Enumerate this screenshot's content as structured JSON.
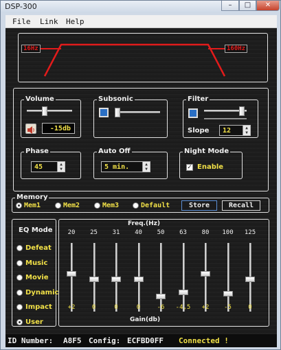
{
  "window": {
    "title": "DSP-300",
    "minimize": "–",
    "maximize": "□",
    "close": "✕"
  },
  "menu": {
    "file": "File",
    "link": "Link",
    "help": "Help"
  },
  "crossover": {
    "low_label": "16Hz",
    "high_label": "160Hz",
    "line_color": "#e21b1b"
  },
  "volume": {
    "title": "Volume",
    "value": "-15db",
    "level": 0.38,
    "icon": "speaker-icon"
  },
  "subsonic": {
    "title": "Subsonic",
    "level": 0.0
  },
  "filter": {
    "title": "Filter",
    "slope_label": "Slope",
    "slope_value": "12",
    "level": 0.95
  },
  "phase": {
    "title": "Phase",
    "value": "45"
  },
  "auto_off": {
    "title": "Auto Off",
    "value": "5 min."
  },
  "night_mode": {
    "title": "Night Mode",
    "enable_label": "Enable",
    "checked": true
  },
  "memory": {
    "title": "Memory",
    "options": [
      "Mem1",
      "Mem2",
      "Mem3",
      "Default"
    ],
    "selected": 0,
    "store": "Store",
    "recall": "Recall"
  },
  "eq_mode": {
    "title": "EQ Mode",
    "options": [
      "Defeat",
      "Music",
      "Movie",
      "Dynamic",
      "Impact",
      "User"
    ],
    "selected": 5
  },
  "eq": {
    "freq_title": "Freq.(Hz)",
    "gain_title": "Gain(db)",
    "bands": [
      {
        "freq": "20",
        "gain": "+2",
        "value": 2
      },
      {
        "freq": "25",
        "gain": "0",
        "value": 0
      },
      {
        "freq": "31",
        "gain": "0",
        "value": 0
      },
      {
        "freq": "40",
        "gain": "0",
        "value": 0
      },
      {
        "freq": "50",
        "gain": "-6",
        "value": -6
      },
      {
        "freq": "63",
        "gain": "-4,5",
        "value": -4.5
      },
      {
        "freq": "80",
        "gain": "+2",
        "value": 2
      },
      {
        "freq": "100",
        "gain": "-5",
        "value": -5
      },
      {
        "freq": "125",
        "gain": "0",
        "value": 0
      }
    ]
  },
  "status": {
    "id_label": "ID Number:",
    "id_value": "A8F5",
    "config_label": "Config:",
    "config_value": "ECFBD0FF",
    "connected": "Connected !"
  }
}
